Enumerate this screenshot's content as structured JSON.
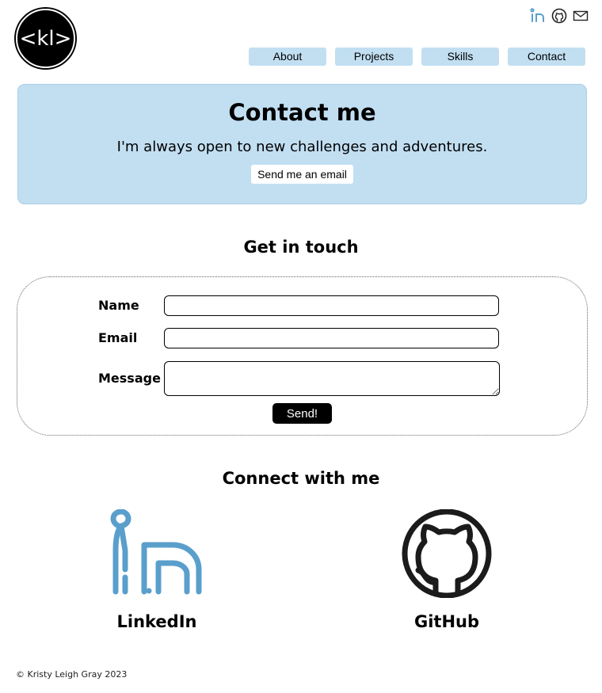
{
  "logo": {
    "text": "<kl>"
  },
  "header_icons": [
    "linkedin-icon",
    "github-icon",
    "mail-icon"
  ],
  "nav": {
    "items": [
      "About",
      "Projects",
      "Skills",
      "Contact"
    ]
  },
  "hero": {
    "title": "Contact me",
    "subtitle": "I'm always open to new challenges and adventures.",
    "button": "Send me an email"
  },
  "contact_form": {
    "title": "Get in touch",
    "name_label": "Name",
    "email_label": "Email",
    "message_label": "Message",
    "name_value": "",
    "email_value": "",
    "message_value": "",
    "submit": "Send!"
  },
  "connect": {
    "title": "Connect with me",
    "links": [
      {
        "label": "LinkedIn",
        "icon": "linkedin-icon",
        "color": "#5a9fcc"
      },
      {
        "label": "GitHub",
        "icon": "github-icon",
        "color": "#1b1b1b"
      }
    ]
  },
  "footer": {
    "text": "© Kristy Leigh Gray 2023"
  },
  "colors": {
    "accent": "#c2dff2",
    "linkedin_blue": "#5a9fcc",
    "button_dark": "#000000"
  }
}
